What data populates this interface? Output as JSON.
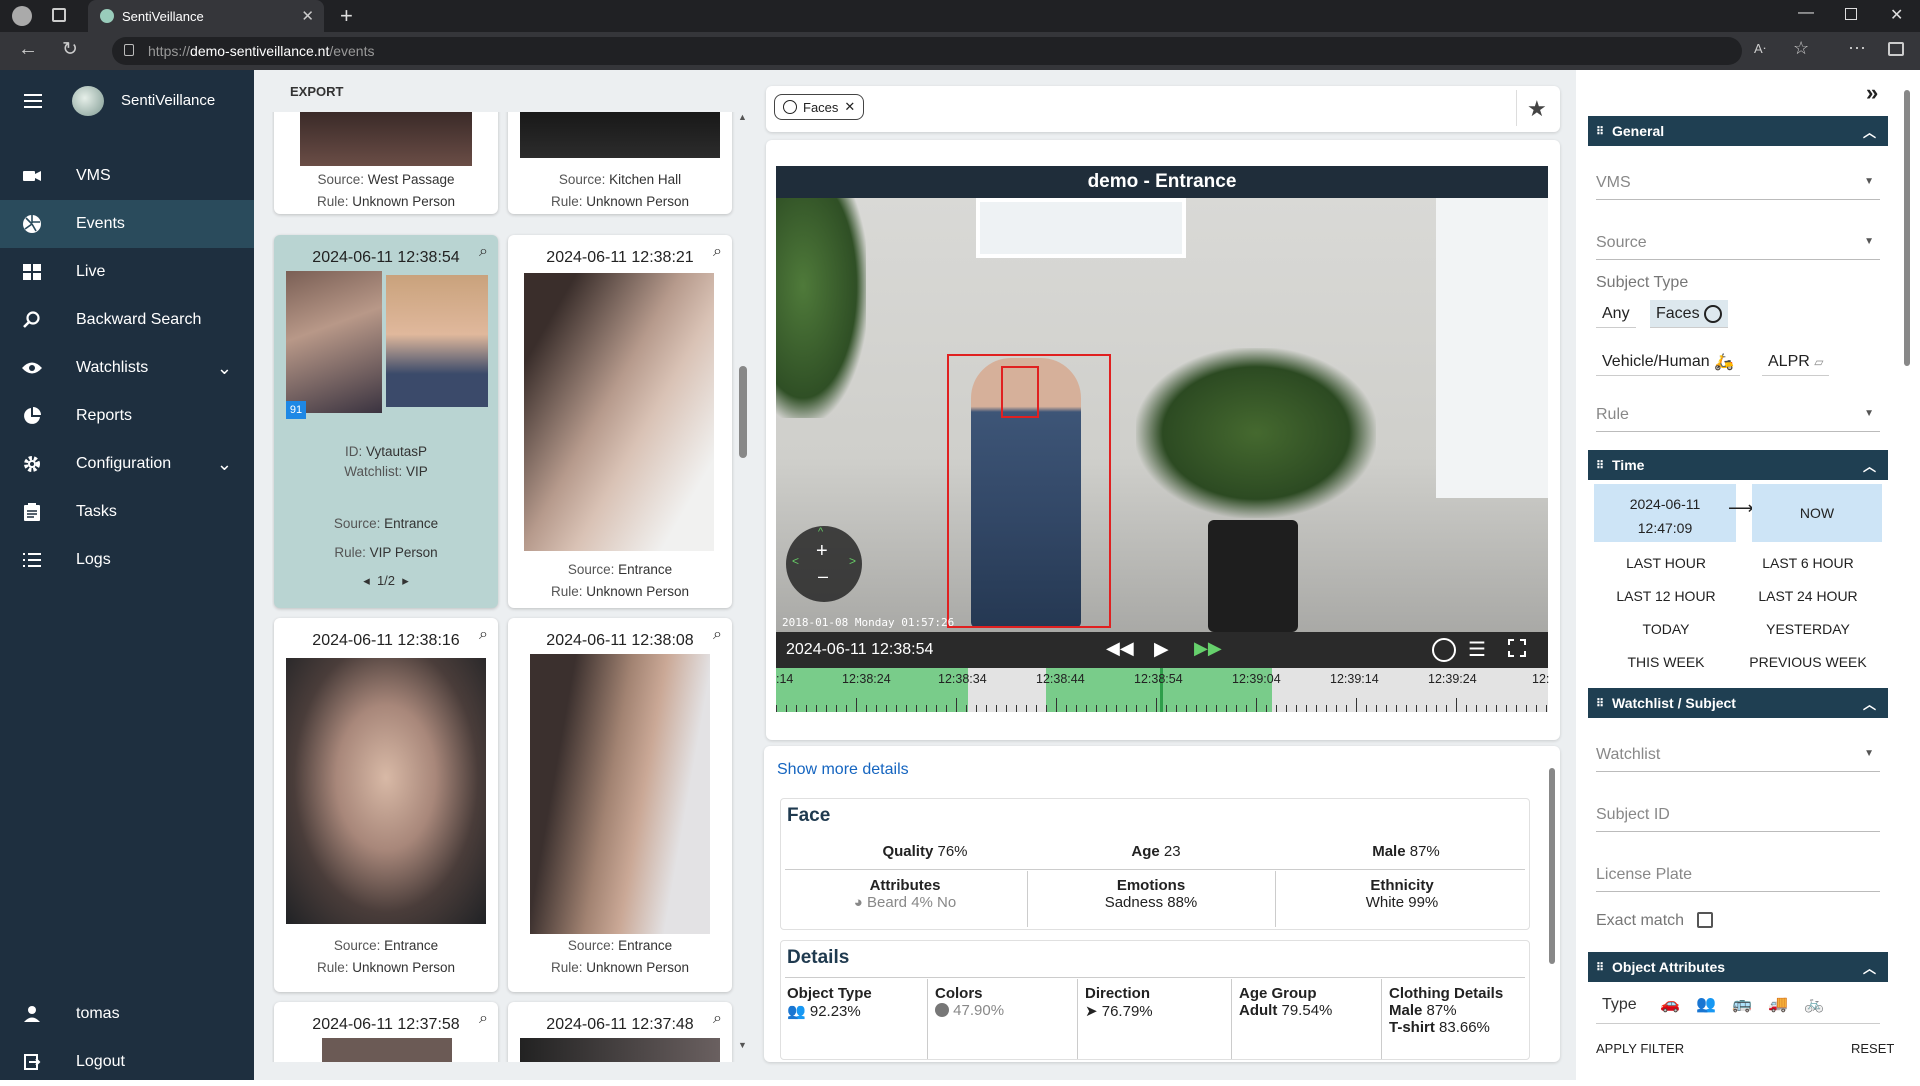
{
  "browser": {
    "tab_title": "SentiVeillance",
    "url_prefix": "https://",
    "url_host": "demo-sentiveillance.nt",
    "url_path": "/events"
  },
  "app": {
    "name": "SentiVeillance"
  },
  "nav": [
    {
      "label": "VMS",
      "icon": "video-camera-icon"
    },
    {
      "label": "Events",
      "icon": "aperture-icon",
      "active": true
    },
    {
      "label": "Live",
      "icon": "live-grid-icon"
    },
    {
      "label": "Backward Search",
      "icon": "search-icon"
    },
    {
      "label": "Watchlists",
      "icon": "eye-icon",
      "expandable": true
    },
    {
      "label": "Reports",
      "icon": "pie-chart-icon"
    },
    {
      "label": "Configuration",
      "icon": "gear-icon",
      "expandable": true
    },
    {
      "label": "Tasks",
      "icon": "clipboard-icon"
    },
    {
      "label": "Logs",
      "icon": "list-icon"
    }
  ],
  "user": {
    "name": "tomas",
    "logout": "Logout"
  },
  "toolbar": {
    "export": "EXPORT"
  },
  "events": {
    "top_cards": [
      {
        "source_label": "Source:",
        "source": "West Passage",
        "rule_label": "Rule:",
        "rule": "Unknown Person"
      },
      {
        "source_label": "Source:",
        "source": "Kitchen Hall",
        "rule_label": "Rule:",
        "rule": "Unknown Person"
      }
    ],
    "selected_card": {
      "timestamp": "2024-06-11 12:38:54",
      "score": "91",
      "id_label": "ID:",
      "id": "VytautasP",
      "watchlist_label": "Watchlist:",
      "watchlist": "VIP",
      "source_label": "Source:",
      "source": "Entrance",
      "rule_label": "Rule:",
      "rule": "VIP Person",
      "pager": "1/2"
    },
    "cards": [
      {
        "timestamp": "2024-06-11 12:38:21",
        "source_label": "Source:",
        "source": "Entrance",
        "rule_label": "Rule:",
        "rule": "Unknown Person"
      },
      {
        "timestamp": "2024-06-11 12:38:16",
        "source_label": "Source:",
        "source": "Entrance",
        "rule_label": "Rule:",
        "rule": "Unknown Person"
      },
      {
        "timestamp": "2024-06-11 12:38:08",
        "source_label": "Source:",
        "source": "Entrance",
        "rule_label": "Rule:",
        "rule": "Unknown Person"
      },
      {
        "timestamp": "2024-06-11 12:37:58"
      },
      {
        "timestamp": "2024-06-11 12:37:48"
      }
    ]
  },
  "filter_chip": {
    "label": "Faces"
  },
  "video": {
    "title": "demo - Entrance",
    "time": "2024-06-11 12:38:54",
    "overlay_date": "2018-01-08 Monday 01:57:26",
    "timeline_ticks": [
      ":14",
      "12:38:24",
      "12:38:34",
      "12:38:44",
      "12:38:54",
      "12:39:04",
      "12:39:14",
      "12:39:24",
      "12:"
    ]
  },
  "details": {
    "show_more": "Show more details",
    "face": {
      "heading": "Face",
      "quality_label": "Quality",
      "quality": "76%",
      "age_label": "Age",
      "age": "23",
      "gender_label": "Male",
      "gender": "87%",
      "attributes_label": "Attributes",
      "attributes": "Beard 4% No",
      "emotions_label": "Emotions",
      "emotions": "Sadness 88%",
      "ethnicity_label": "Ethnicity",
      "ethnicity": "White 99%"
    },
    "details": {
      "heading": "Details",
      "object_type_label": "Object Type",
      "object_type": "92.23%",
      "colors_label": "Colors",
      "colors": "47.90%",
      "direction_label": "Direction",
      "direction": "76.79%",
      "age_group_label": "Age Group",
      "age_group_name": "Adult",
      "age_group": "79.54%",
      "clothing_label": "Clothing Details",
      "clothing_1_name": "Male",
      "clothing_1": "87%",
      "clothing_2_name": "T-shirt",
      "clothing_2": "83.66%"
    }
  },
  "filters": {
    "general": {
      "heading": "General",
      "vms_placeholder": "VMS",
      "source_placeholder": "Source",
      "subject_type_label": "Subject Type",
      "any": "Any",
      "faces": "Faces",
      "vehicle_human": "Vehicle/Human",
      "alpr": "ALPR",
      "rule_placeholder": "Rule"
    },
    "time": {
      "heading": "Time",
      "from_date": "2024-06-11",
      "from_time": "12:47:09",
      "to": "NOW",
      "buttons": [
        "LAST HOUR",
        "LAST 6 HOUR",
        "LAST 12 HOUR",
        "LAST 24 HOUR",
        "TODAY",
        "YESTERDAY",
        "THIS WEEK",
        "PREVIOUS WEEK"
      ]
    },
    "watchlist": {
      "heading": "Watchlist / Subject",
      "watchlist_placeholder": "Watchlist",
      "subject_id_placeholder": "Subject ID",
      "license_plate_placeholder": "License Plate",
      "exact_match": "Exact match"
    },
    "object_attributes": {
      "heading": "Object Attributes",
      "type_label": "Type"
    },
    "apply": "APPLY FILTER",
    "reset": "RESET"
  },
  "colors": {
    "sidebar_bg": "#1e2f3f",
    "active_nav": "#2a4b5c",
    "header_bg": "#1f3f52",
    "timeline_green": "#79cc8a",
    "selected_card": "#b9d4d2"
  }
}
